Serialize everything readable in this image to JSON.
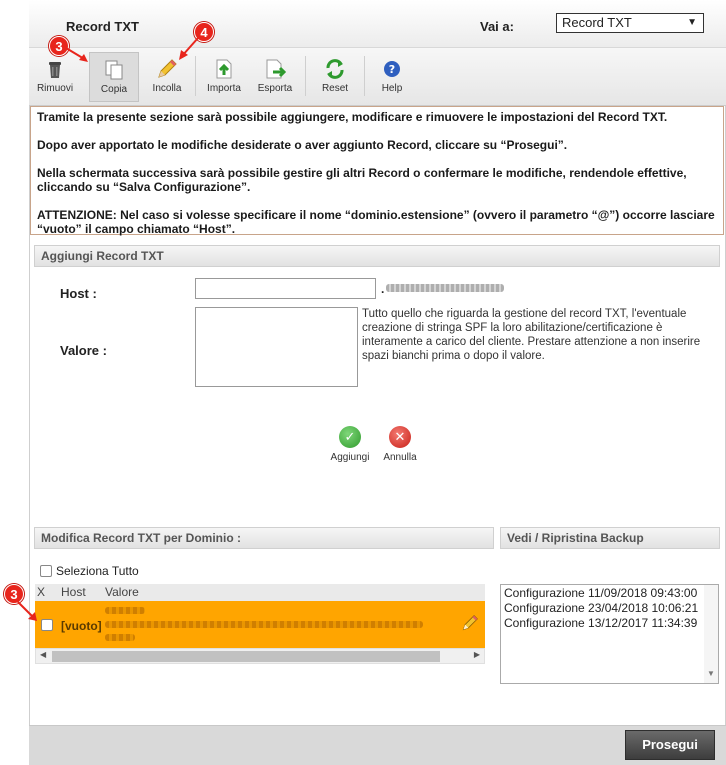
{
  "header": {
    "title": "Record TXT",
    "goto_label": "Vai a:",
    "goto_selected": "Record TXT"
  },
  "toolbar": {
    "rimuovi": "Rimuovi",
    "copia": "Copia",
    "incolla": "Incolla",
    "importa": "Importa",
    "esporta": "Esporta",
    "reset": "Reset",
    "help": "Help"
  },
  "info": {
    "p1": "Tramite la presente sezione sarà possibile aggiungere, modificare e rimuovere le impostazioni del Record TXT.",
    "p2": "Dopo aver apportato le modifiche desiderate o aver aggiunto Record, cliccare su “Prosegui”.",
    "p3": "Nella schermata successiva sarà possibile gestire gli altri Record o confermare le modifiche, rendendole effettive, cliccando su “Salva Configurazione”.",
    "p4": "ATTENZIONE: Nel caso si volesse specificare il nome “dominio.estensione” (ovvero il parametro “@”) occorre lasciare “vuoto” il campo chiamato “Host”."
  },
  "add_section": {
    "title": "Aggiungi Record TXT",
    "host_label": "Host :",
    "dot": ".",
    "valore_label": "Valore :",
    "help": "Tutto quello che riguarda la gestione del record TXT, l'eventuale creazione di stringa SPF la loro abilitazione/certificazione è interamente a carico del cliente. Prestare attenzione a non inserire spazi bianchi prima o dopo il valore.",
    "aggiungi": "Aggiungi",
    "annulla": "Annulla"
  },
  "edit_section": {
    "title": "Modifica Record TXT per Dominio :",
    "select_all": "Seleziona Tutto",
    "col_x": "X",
    "col_host": "Host",
    "col_valore": "Valore",
    "row_host": "[vuoto]"
  },
  "backup_section": {
    "title": "Vedi / Ripristina Backup",
    "items": [
      "Configurazione 11/09/2018 09:43:00",
      "Configurazione 23/04/2018 10:06:21",
      "Configurazione 13/12/2017 11:34:39"
    ]
  },
  "footer": {
    "prosegui": "Prosegui"
  },
  "badges": {
    "copia": "3",
    "incolla": "4",
    "row": "3"
  },
  "colors": {
    "row_highlight": "#ffa500",
    "badge": "#e8251c",
    "ok_green": "#3aa537",
    "cancel_red": "#d9261c"
  }
}
